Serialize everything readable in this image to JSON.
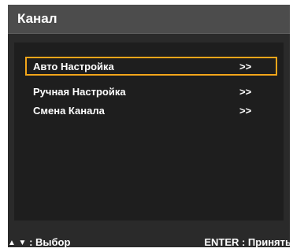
{
  "menu": {
    "title": "Канал",
    "items": [
      {
        "label": "Авто Настройка",
        "arrow": ">>",
        "selected": true
      },
      {
        "label": "Ручная Настройка",
        "arrow": ">>",
        "selected": false
      },
      {
        "label": "Смена Канала",
        "arrow": ">>",
        "selected": false
      }
    ]
  },
  "footer": {
    "up_icon": "▲",
    "down_icon": "▼",
    "select_hint": ": Выбор",
    "enter_hint": "ENTER : Принять"
  },
  "colors": {
    "highlight_border": "#f2a51a",
    "title_bar": "#4c4c4c",
    "panel": "#2a2a2a",
    "content": "#1e1e1e"
  }
}
